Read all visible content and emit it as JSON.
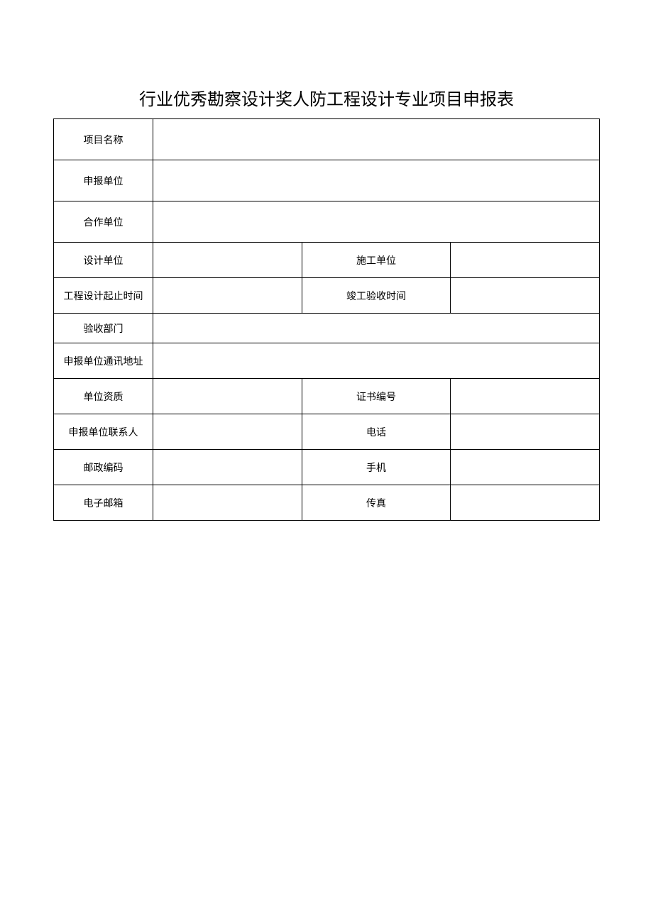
{
  "title": "行业优秀勘察设计奖人防工程设计专业项目申报表",
  "rows": {
    "project_name_label": "项目名称",
    "project_name": "",
    "applicant_unit_label": "申报单位",
    "applicant_unit": "",
    "cooperation_unit_label": "合作单位",
    "cooperation_unit": "",
    "design_unit_label": "设计单位",
    "design_unit": "",
    "construction_unit_label": "施工单位",
    "construction_unit": "",
    "design_period_label": "工程设计起止时间",
    "design_period": "",
    "acceptance_time_label": "竣工验收时间",
    "acceptance_time": "",
    "acceptance_dept_label": "验收部门",
    "acceptance_dept": "",
    "mailing_address_label": "申报单位通讯地址",
    "mailing_address": "",
    "qualification_label": "单位资质",
    "qualification": "",
    "certificate_no_label": "证书编号",
    "certificate_no": "",
    "contact_person_label": "申报单位联系人",
    "contact_person": "",
    "phone_label": "电话",
    "phone": "",
    "postal_code_label": "邮政编码",
    "postal_code": "",
    "mobile_label": "手机",
    "mobile": "",
    "email_label": "电子邮箱",
    "email": "",
    "fax_label": "传真",
    "fax": ""
  }
}
